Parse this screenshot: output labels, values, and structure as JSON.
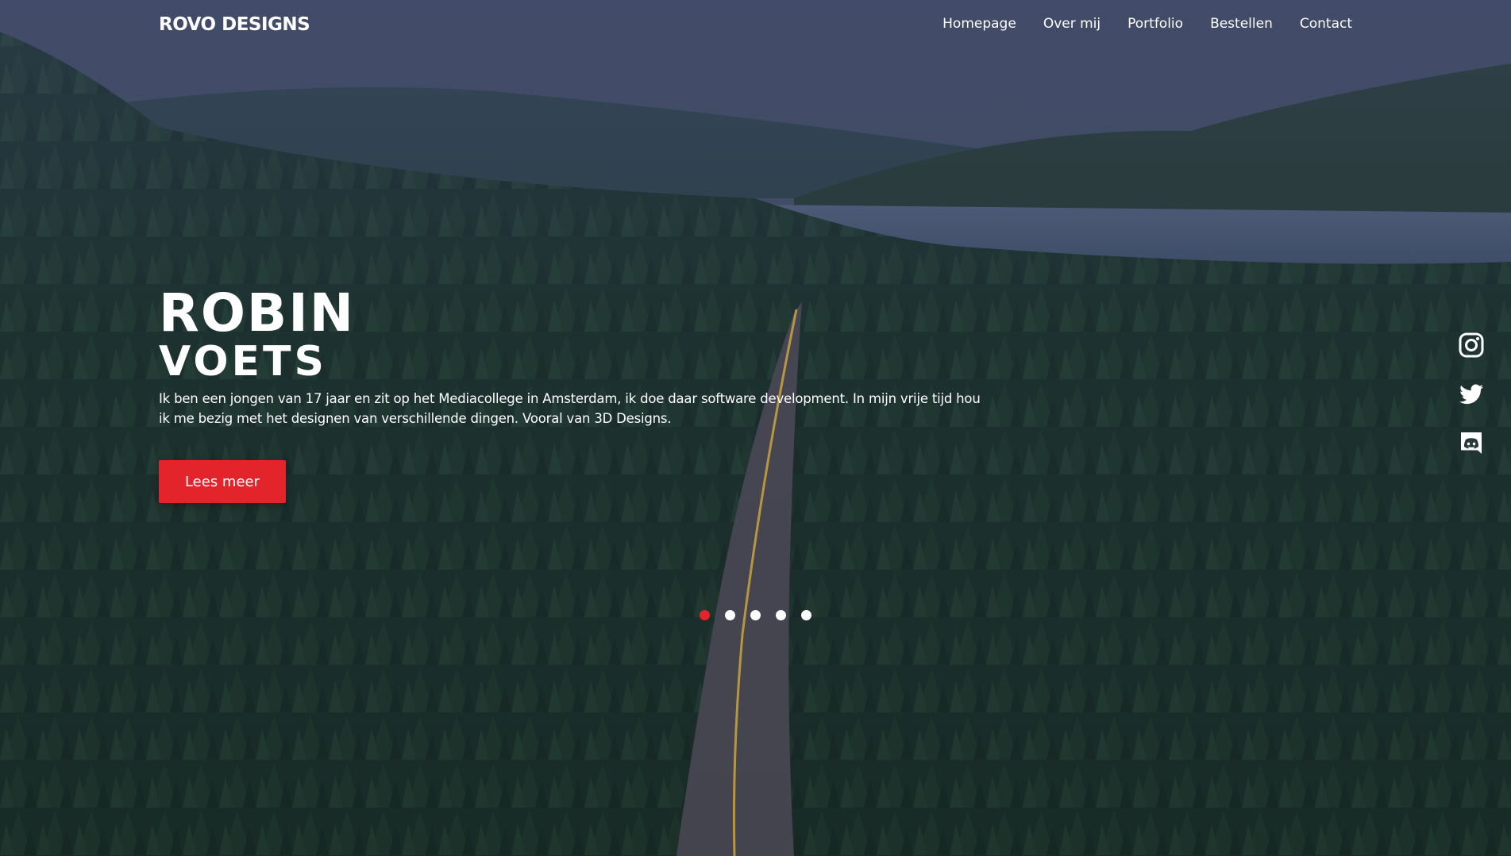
{
  "brand": {
    "logo": "ROVO DESIGNS",
    "accent_color": "#e3242b"
  },
  "nav": {
    "items": [
      {
        "label": "Homepage"
      },
      {
        "label": "Over mij"
      },
      {
        "label": "Portfolio"
      },
      {
        "label": "Bestellen"
      },
      {
        "label": "Contact"
      }
    ]
  },
  "hero": {
    "first_name": "ROBIN",
    "last_name": "VOETS",
    "bio": "Ik ben een jongen van 17 jaar en zit op het Mediacollege in Amsterdam, ik doe daar software development. In mijn vrije tijd hou ik me bezig met het designen van verschillende dingen. Vooral van 3D Designs.",
    "cta_label": "Lees meer",
    "background": "aerial forest road with lake and mountains"
  },
  "social": [
    {
      "icon": "instagram-icon"
    },
    {
      "icon": "twitter-icon"
    },
    {
      "icon": "discord-icon"
    }
  ],
  "slider": {
    "total": 5,
    "active": 1
  }
}
